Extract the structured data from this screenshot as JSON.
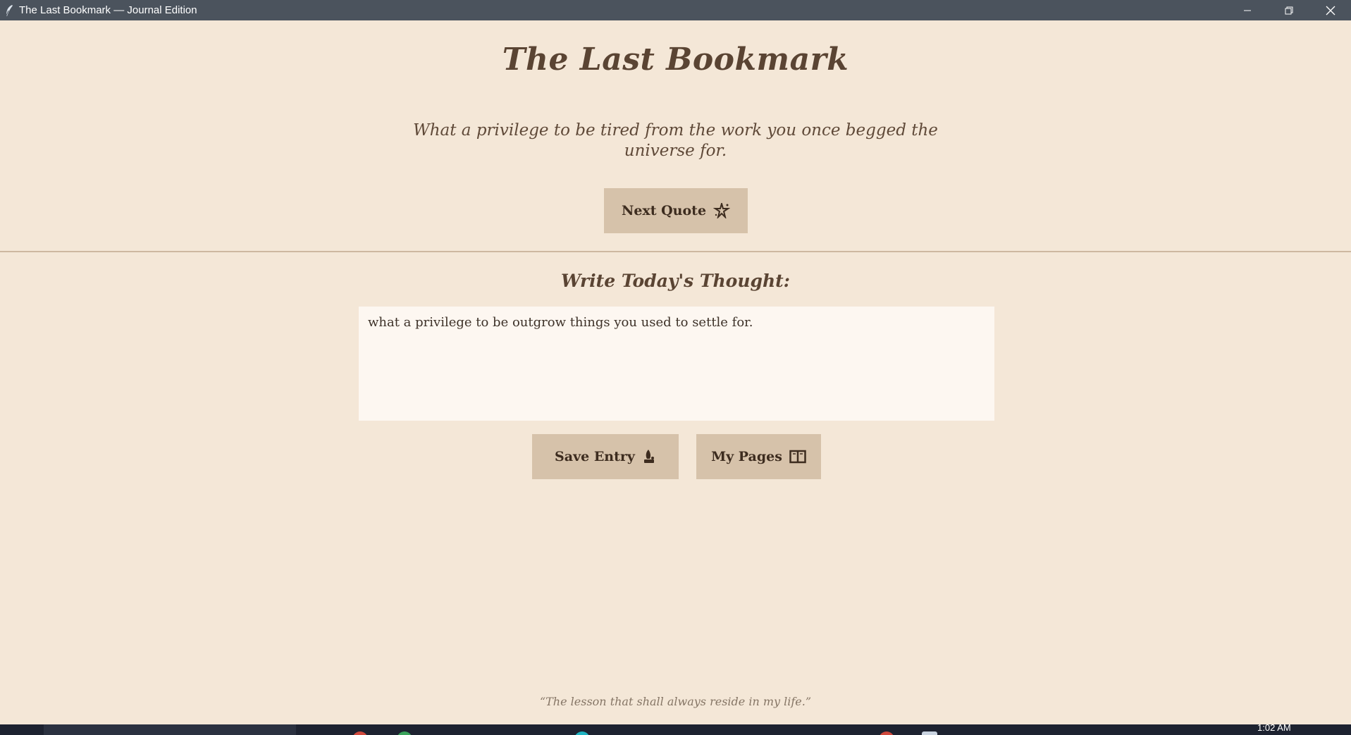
{
  "window": {
    "title": "The Last Bookmark — Journal Edition",
    "icon": "feather-icon",
    "controls": [
      "minimize-icon",
      "restore-icon",
      "close-icon"
    ]
  },
  "app": {
    "title": "The Last Bookmark",
    "quote": "What a privilege to be tired from the work you once begged the universe for.",
    "next_quote_label": "Next Quote",
    "next_quote_icon": "sparkle-icon",
    "section_heading": "Write Today's Thought:",
    "entry_value": "what a privilege to be outgrow things you used to settle for.",
    "save_label": "Save Entry",
    "save_icon": "quill-ink-icon",
    "pages_label": "My Pages",
    "pages_icon": "open-book-icon",
    "footer_quote": "“The lesson that shall always reside in my life.”"
  },
  "taskbar": {
    "clock": "1:02 AM"
  },
  "colors": {
    "background": "#f4e7d7",
    "button": "#d6c2aa",
    "title_text": "#5a4433",
    "titlebar": "#4b535d"
  }
}
